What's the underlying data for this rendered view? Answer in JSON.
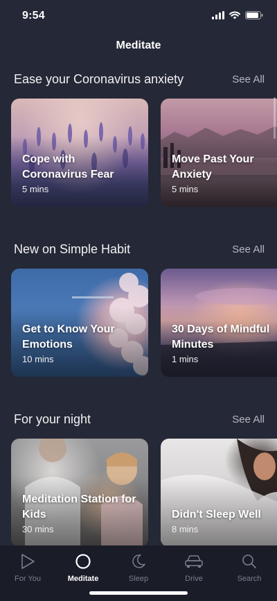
{
  "status": {
    "time": "9:54"
  },
  "header": {
    "title": "Meditate"
  },
  "sections": [
    {
      "title": "Ease your Coronavirus anxiety",
      "see_all": "See All",
      "cards": [
        {
          "title": "Cope with Coronavirus Fear",
          "duration": "5 mins"
        },
        {
          "title": "Move Past Your Anxiety",
          "duration": "5 mins"
        }
      ]
    },
    {
      "title": "New on Simple Habit",
      "see_all": "See All",
      "cards": [
        {
          "title": "Get to Know Your Emotions",
          "duration": "10 mins"
        },
        {
          "title": "30 Days of Mindful Minutes",
          "duration": "1 mins"
        }
      ]
    },
    {
      "title": "For your night",
      "see_all": "See All",
      "cards": [
        {
          "title": "Meditation Station for Kids",
          "duration": "30 mins"
        },
        {
          "title": "Didn't Sleep Well",
          "duration": "8 mins"
        }
      ]
    }
  ],
  "tabs": [
    {
      "label": "For You",
      "icon": "play-icon"
    },
    {
      "label": "Meditate",
      "icon": "circle-icon"
    },
    {
      "label": "Sleep",
      "icon": "moon-icon"
    },
    {
      "label": "Drive",
      "icon": "car-icon"
    },
    {
      "label": "Search",
      "icon": "search-icon"
    }
  ],
  "active_tab": "Meditate",
  "colors": {
    "background": "#252836",
    "tab_bar": "#1a1c28",
    "inactive": "#7c7f8c",
    "see_all": "#b7b9c2"
  }
}
